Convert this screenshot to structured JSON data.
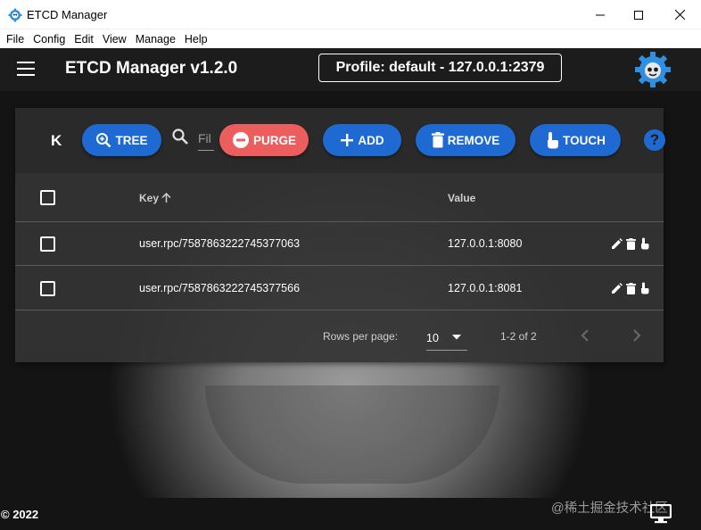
{
  "window": {
    "title": "ETCD Manager"
  },
  "menu": [
    "File",
    "Config",
    "Edit",
    "View",
    "Manage",
    "Help"
  ],
  "appbar": {
    "title": "ETCD Manager v1.2.0",
    "profile": "Profile: default - 127.0.0.1:2379"
  },
  "toolbar": {
    "k_label": "K",
    "tree_label": "TREE",
    "filter_placeholder": "Fil",
    "purge_label": "PURGE",
    "add_label": "ADD",
    "remove_label": "REMOVE",
    "touch_label": "TOUCH"
  },
  "table": {
    "columns": {
      "key": "Key",
      "value": "Value"
    },
    "rows": [
      {
        "key": "user.rpc/7587863222745377063",
        "value": "127.0.0.1:8080"
      },
      {
        "key": "user.rpc/7587863222745377566",
        "value": "127.0.0.1:8081"
      }
    ]
  },
  "pagination": {
    "rows_per_page_label": "Rows per page:",
    "rows_per_page": "10",
    "range": "1-2 of 2"
  },
  "footer": {
    "copyright": "© 2022",
    "watermark": "@稀土掘金技术社区"
  },
  "colors": {
    "primary": "#1e6ad2",
    "danger": "#ec5e5e",
    "appbar": "#1c1c1c",
    "logo": "#2f8fe0"
  },
  "icons": [
    "app-icon",
    "minimize-icon",
    "maximize-icon",
    "close-icon",
    "menu-icon",
    "logo-icon",
    "zoom-in-icon",
    "search-icon",
    "minus-circle-icon",
    "plus-icon",
    "delete-icon",
    "touch-icon",
    "help-icon",
    "arrow-up-icon",
    "edit-icon",
    "chevron-down-icon",
    "chevron-left-icon",
    "chevron-right-icon",
    "monitor-icon"
  ]
}
